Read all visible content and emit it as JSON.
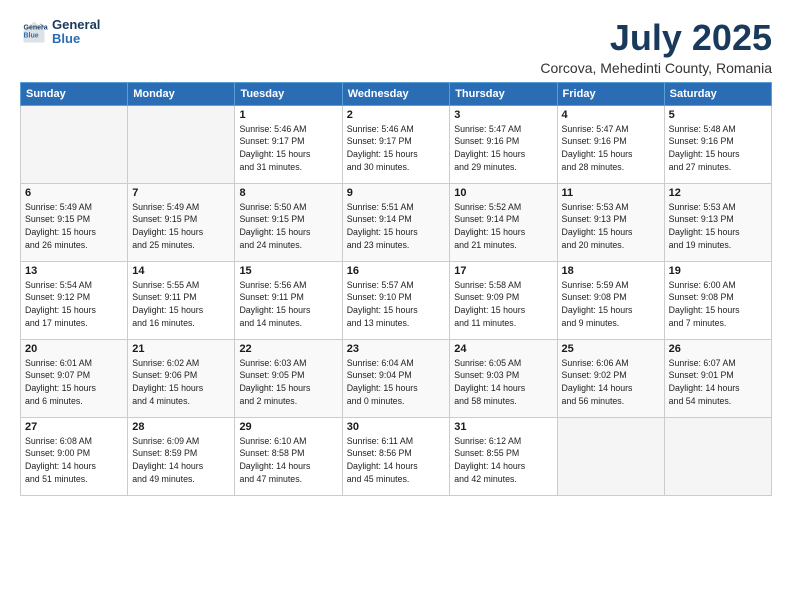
{
  "logo": {
    "line1": "General",
    "line2": "Blue"
  },
  "title": "July 2025",
  "subtitle": "Corcova, Mehedinti County, Romania",
  "days_of_week": [
    "Sunday",
    "Monday",
    "Tuesday",
    "Wednesday",
    "Thursday",
    "Friday",
    "Saturday"
  ],
  "weeks": [
    [
      {
        "day": "",
        "info": ""
      },
      {
        "day": "",
        "info": ""
      },
      {
        "day": "1",
        "info": "Sunrise: 5:46 AM\nSunset: 9:17 PM\nDaylight: 15 hours\nand 31 minutes."
      },
      {
        "day": "2",
        "info": "Sunrise: 5:46 AM\nSunset: 9:17 PM\nDaylight: 15 hours\nand 30 minutes."
      },
      {
        "day": "3",
        "info": "Sunrise: 5:47 AM\nSunset: 9:16 PM\nDaylight: 15 hours\nand 29 minutes."
      },
      {
        "day": "4",
        "info": "Sunrise: 5:47 AM\nSunset: 9:16 PM\nDaylight: 15 hours\nand 28 minutes."
      },
      {
        "day": "5",
        "info": "Sunrise: 5:48 AM\nSunset: 9:16 PM\nDaylight: 15 hours\nand 27 minutes."
      }
    ],
    [
      {
        "day": "6",
        "info": "Sunrise: 5:49 AM\nSunset: 9:15 PM\nDaylight: 15 hours\nand 26 minutes."
      },
      {
        "day": "7",
        "info": "Sunrise: 5:49 AM\nSunset: 9:15 PM\nDaylight: 15 hours\nand 25 minutes."
      },
      {
        "day": "8",
        "info": "Sunrise: 5:50 AM\nSunset: 9:15 PM\nDaylight: 15 hours\nand 24 minutes."
      },
      {
        "day": "9",
        "info": "Sunrise: 5:51 AM\nSunset: 9:14 PM\nDaylight: 15 hours\nand 23 minutes."
      },
      {
        "day": "10",
        "info": "Sunrise: 5:52 AM\nSunset: 9:14 PM\nDaylight: 15 hours\nand 21 minutes."
      },
      {
        "day": "11",
        "info": "Sunrise: 5:53 AM\nSunset: 9:13 PM\nDaylight: 15 hours\nand 20 minutes."
      },
      {
        "day": "12",
        "info": "Sunrise: 5:53 AM\nSunset: 9:13 PM\nDaylight: 15 hours\nand 19 minutes."
      }
    ],
    [
      {
        "day": "13",
        "info": "Sunrise: 5:54 AM\nSunset: 9:12 PM\nDaylight: 15 hours\nand 17 minutes."
      },
      {
        "day": "14",
        "info": "Sunrise: 5:55 AM\nSunset: 9:11 PM\nDaylight: 15 hours\nand 16 minutes."
      },
      {
        "day": "15",
        "info": "Sunrise: 5:56 AM\nSunset: 9:11 PM\nDaylight: 15 hours\nand 14 minutes."
      },
      {
        "day": "16",
        "info": "Sunrise: 5:57 AM\nSunset: 9:10 PM\nDaylight: 15 hours\nand 13 minutes."
      },
      {
        "day": "17",
        "info": "Sunrise: 5:58 AM\nSunset: 9:09 PM\nDaylight: 15 hours\nand 11 minutes."
      },
      {
        "day": "18",
        "info": "Sunrise: 5:59 AM\nSunset: 9:08 PM\nDaylight: 15 hours\nand 9 minutes."
      },
      {
        "day": "19",
        "info": "Sunrise: 6:00 AM\nSunset: 9:08 PM\nDaylight: 15 hours\nand 7 minutes."
      }
    ],
    [
      {
        "day": "20",
        "info": "Sunrise: 6:01 AM\nSunset: 9:07 PM\nDaylight: 15 hours\nand 6 minutes."
      },
      {
        "day": "21",
        "info": "Sunrise: 6:02 AM\nSunset: 9:06 PM\nDaylight: 15 hours\nand 4 minutes."
      },
      {
        "day": "22",
        "info": "Sunrise: 6:03 AM\nSunset: 9:05 PM\nDaylight: 15 hours\nand 2 minutes."
      },
      {
        "day": "23",
        "info": "Sunrise: 6:04 AM\nSunset: 9:04 PM\nDaylight: 15 hours\nand 0 minutes."
      },
      {
        "day": "24",
        "info": "Sunrise: 6:05 AM\nSunset: 9:03 PM\nDaylight: 14 hours\nand 58 minutes."
      },
      {
        "day": "25",
        "info": "Sunrise: 6:06 AM\nSunset: 9:02 PM\nDaylight: 14 hours\nand 56 minutes."
      },
      {
        "day": "26",
        "info": "Sunrise: 6:07 AM\nSunset: 9:01 PM\nDaylight: 14 hours\nand 54 minutes."
      }
    ],
    [
      {
        "day": "27",
        "info": "Sunrise: 6:08 AM\nSunset: 9:00 PM\nDaylight: 14 hours\nand 51 minutes."
      },
      {
        "day": "28",
        "info": "Sunrise: 6:09 AM\nSunset: 8:59 PM\nDaylight: 14 hours\nand 49 minutes."
      },
      {
        "day": "29",
        "info": "Sunrise: 6:10 AM\nSunset: 8:58 PM\nDaylight: 14 hours\nand 47 minutes."
      },
      {
        "day": "30",
        "info": "Sunrise: 6:11 AM\nSunset: 8:56 PM\nDaylight: 14 hours\nand 45 minutes."
      },
      {
        "day": "31",
        "info": "Sunrise: 6:12 AM\nSunset: 8:55 PM\nDaylight: 14 hours\nand 42 minutes."
      },
      {
        "day": "",
        "info": ""
      },
      {
        "day": "",
        "info": ""
      }
    ]
  ]
}
